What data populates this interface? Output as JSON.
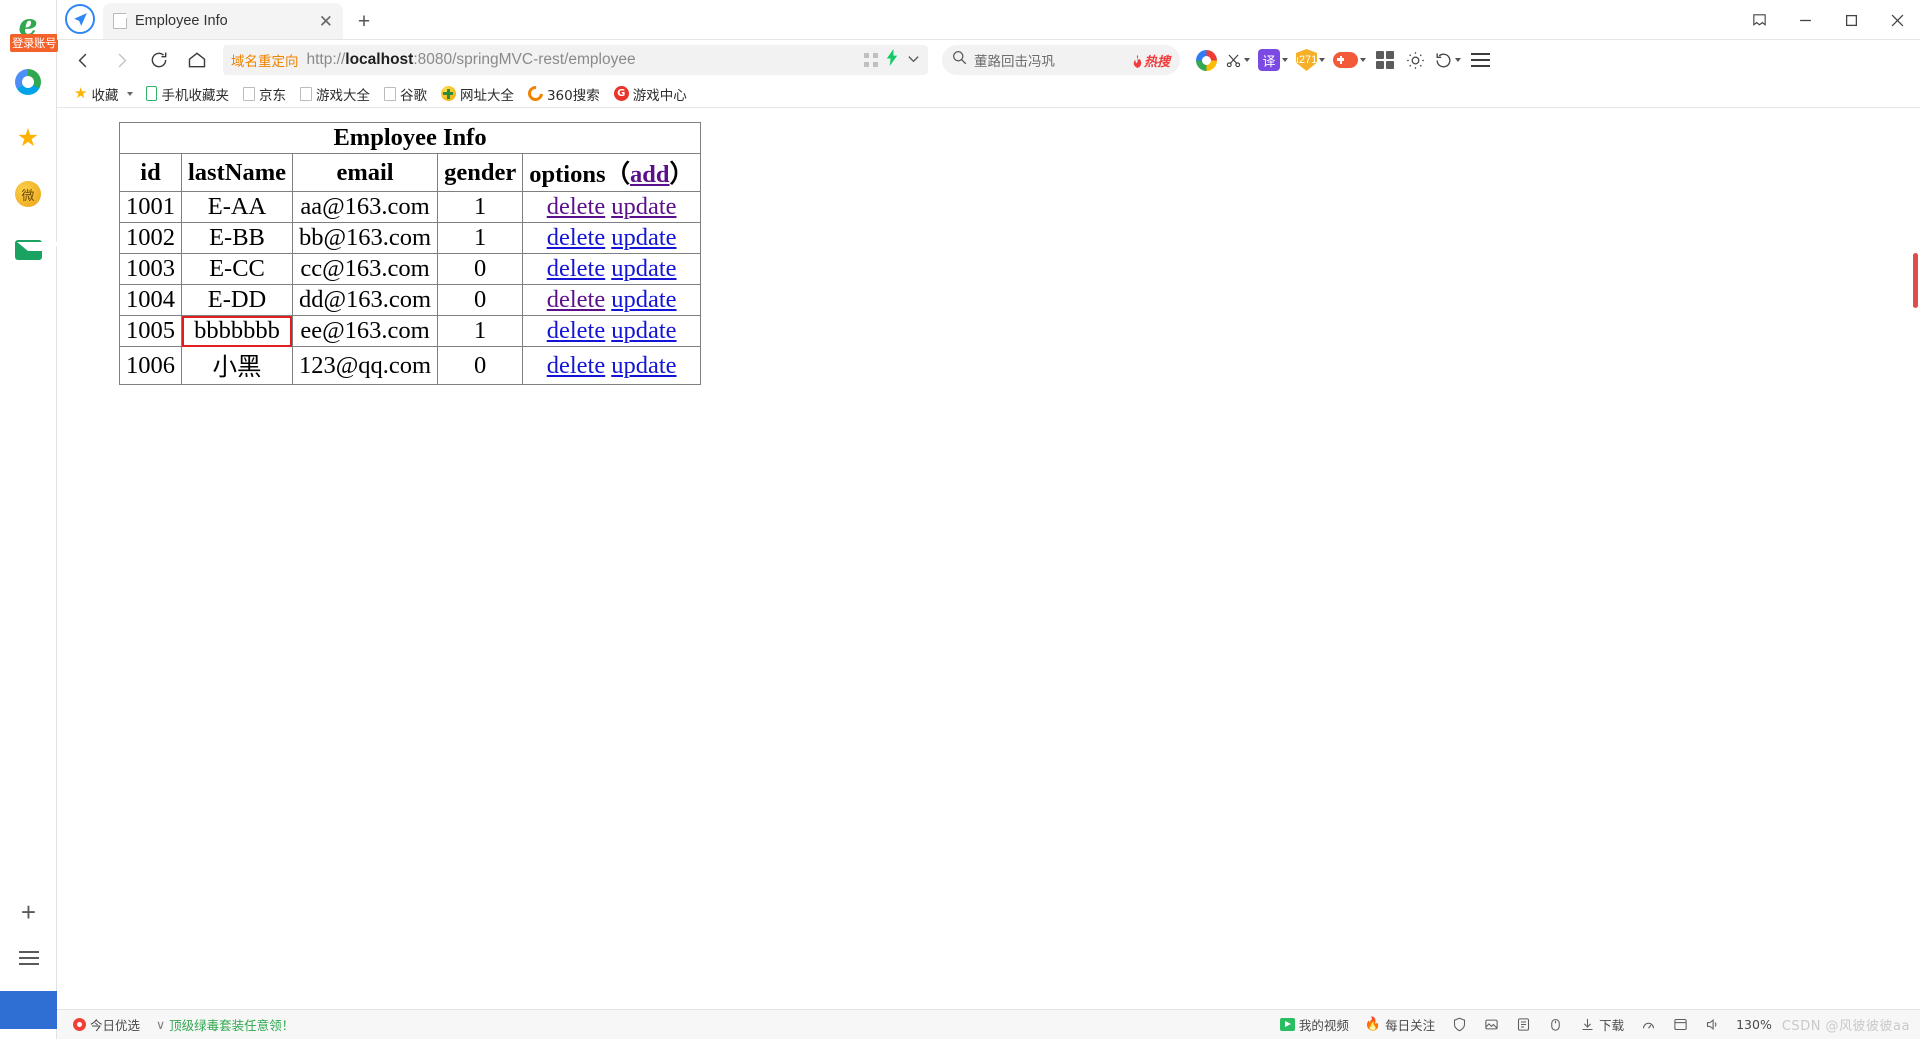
{
  "window": {
    "title": "Employee Info",
    "controls": {
      "restore": "❐",
      "minimize": "─",
      "maximize": "□",
      "close": "✕"
    }
  },
  "sidebar": {
    "login_badge": "登录账号",
    "items": [
      {
        "name": "ie-logo-icon",
        "label": "e"
      },
      {
        "name": "chrome-icon",
        "label": ""
      },
      {
        "name": "favorites-star-icon",
        "label": "★"
      },
      {
        "name": "weibo-icon",
        "label": "微"
      },
      {
        "name": "mail-icon",
        "label": ""
      }
    ],
    "bottom": [
      {
        "name": "add-panel-icon",
        "label": "+"
      },
      {
        "name": "list-panel-icon",
        "label": ""
      }
    ]
  },
  "tabbar": {
    "tab_title": "Employee Info",
    "close_label": "✕",
    "newtab_label": "+"
  },
  "toolbar": {
    "back": "‹",
    "forward": "›",
    "reload": "↻",
    "home": "⌂",
    "redirect_badge": "域名重定向",
    "url_scheme": "http://",
    "url_host": "localhost",
    "url_rest": ":8080/springMVC-rest/employee",
    "url_full": "http://localhost:8080/springMVC-rest/employee",
    "bolt": "⚡",
    "chevron": "⌄",
    "icons": [
      {
        "name": "360-browser-icon",
        "label": ""
      },
      {
        "name": "screenshot-scissors-icon",
        "label": "✂"
      },
      {
        "name": "translate-icon",
        "label": "译"
      },
      {
        "name": "shield-protect-icon",
        "label": ""
      },
      {
        "name": "game-controller-icon",
        "label": ""
      },
      {
        "name": "apps-grid-icon",
        "label": ""
      },
      {
        "name": "theme-sun-icon",
        "label": ""
      },
      {
        "name": "history-undo-icon",
        "label": "↺"
      },
      {
        "name": "menu-hamburger-icon",
        "label": ""
      }
    ]
  },
  "search": {
    "placeholder": "董路回击冯巩",
    "value": "董路回击冯巩",
    "hot_label": "热搜",
    "icon": "search-icon"
  },
  "bookmarks": [
    {
      "icon": "star-icon",
      "label": "收藏"
    },
    {
      "icon": "phone-icon",
      "label": "手机收藏夹"
    },
    {
      "icon": "page-icon",
      "label": "京东"
    },
    {
      "icon": "page-icon",
      "label": "游戏大全"
    },
    {
      "icon": "page-icon",
      "label": "谷歌"
    },
    {
      "icon": "hao123-icon",
      "label": "网址大全"
    },
    {
      "icon": "360-search-icon",
      "label": "360搜索"
    },
    {
      "icon": "game-center-icon",
      "label": "游戏中心"
    }
  ],
  "page": {
    "table_caption": "Employee Info",
    "headers": [
      "id",
      "lastName",
      "email",
      "gender",
      "options"
    ],
    "options_header_prefix": "options（",
    "options_header_add": "add",
    "options_header_suffix": "）",
    "action_delete": "delete",
    "action_update": "update",
    "rows": [
      {
        "id": "1001",
        "lastName": "E-AA",
        "email": "aa@163.com",
        "gender": "1",
        "delete_visited": true,
        "update_visited": true,
        "highlight": false
      },
      {
        "id": "1002",
        "lastName": "E-BB",
        "email": "bb@163.com",
        "gender": "1",
        "delete_visited": false,
        "update_visited": false,
        "highlight": false
      },
      {
        "id": "1003",
        "lastName": "E-CC",
        "email": "cc@163.com",
        "gender": "0",
        "delete_visited": false,
        "update_visited": false,
        "highlight": false
      },
      {
        "id": "1004",
        "lastName": "E-DD",
        "email": "dd@163.com",
        "gender": "0",
        "delete_visited": true,
        "update_visited": false,
        "highlight": false
      },
      {
        "id": "1005",
        "lastName": "bbbbbbb",
        "email": "ee@163.com",
        "gender": "1",
        "delete_visited": false,
        "update_visited": false,
        "highlight": true
      },
      {
        "id": "1006",
        "lastName": "小黑",
        "email": "123@qq.com",
        "gender": "0",
        "delete_visited": false,
        "update_visited": false,
        "highlight": false
      }
    ],
    "highlight_color": "#e02020"
  },
  "statusbar": {
    "left": [
      {
        "icon": "360-today-icon",
        "label": "今日优选"
      },
      {
        "icon": "chevron-icon",
        "label": "顶级绿毒套装任意领！"
      }
    ],
    "right": [
      {
        "icon": "video-icon",
        "label": "我的视频"
      },
      {
        "icon": "fire-icon",
        "label": "每日关注"
      },
      {
        "icon": "shield-icon",
        "label": ""
      },
      {
        "icon": "image-icon",
        "label": ""
      },
      {
        "icon": "note-icon",
        "label": ""
      },
      {
        "icon": "mouse-icon",
        "label": ""
      },
      {
        "icon": "download-icon",
        "label": "下载"
      },
      {
        "icon": "speed-icon",
        "label": ""
      },
      {
        "icon": "window-icon",
        "label": ""
      },
      {
        "icon": "volume-icon",
        "label": ""
      }
    ],
    "zoom_label": "130%",
    "watermark": "CSDN @风彼彼彼aa"
  }
}
